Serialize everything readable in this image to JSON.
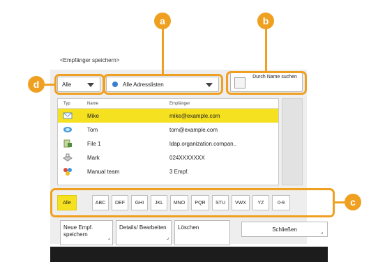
{
  "title": "<Empfänger speichern>",
  "filter_dropdown": {
    "value": "Alle"
  },
  "address_list_dropdown": {
    "value": "Alle Adresslisten"
  },
  "name_search_button": {
    "label": "Durch Name suchen"
  },
  "table": {
    "columns": [
      "Typ",
      "Name",
      "Empfänger"
    ],
    "rows": [
      {
        "icon": "email-icon",
        "name": "Mike",
        "recipient": "mike@example.com",
        "selected": true
      },
      {
        "icon": "ifax-icon",
        "name": "Tom",
        "recipient": "tom@example.com",
        "selected": false
      },
      {
        "icon": "file-server-icon",
        "name": "File 1",
        "recipient": "ldap.organization.compan..",
        "selected": false
      },
      {
        "icon": "fax-icon",
        "name": "Mark",
        "recipient": "024XXXXXXX",
        "selected": false
      },
      {
        "icon": "group-icon",
        "name": "Manual team",
        "recipient": "3 Empf.",
        "selected": false
      }
    ]
  },
  "alphabet_buttons": [
    "Alle",
    "ABC",
    "DEF",
    "GHI",
    "JKL",
    "MNO",
    "PQR",
    "STU",
    "VWX",
    "YZ",
    "0-9"
  ],
  "buttons": {
    "new": "Neue Empf. speichern",
    "details": "Details/ Bearbeiten",
    "delete": "Löschen",
    "close": "Schließen"
  },
  "callouts": [
    "a",
    "b",
    "c",
    "d"
  ],
  "colors": {
    "highlight": "#f5e11f",
    "callout": "#f0a020"
  }
}
